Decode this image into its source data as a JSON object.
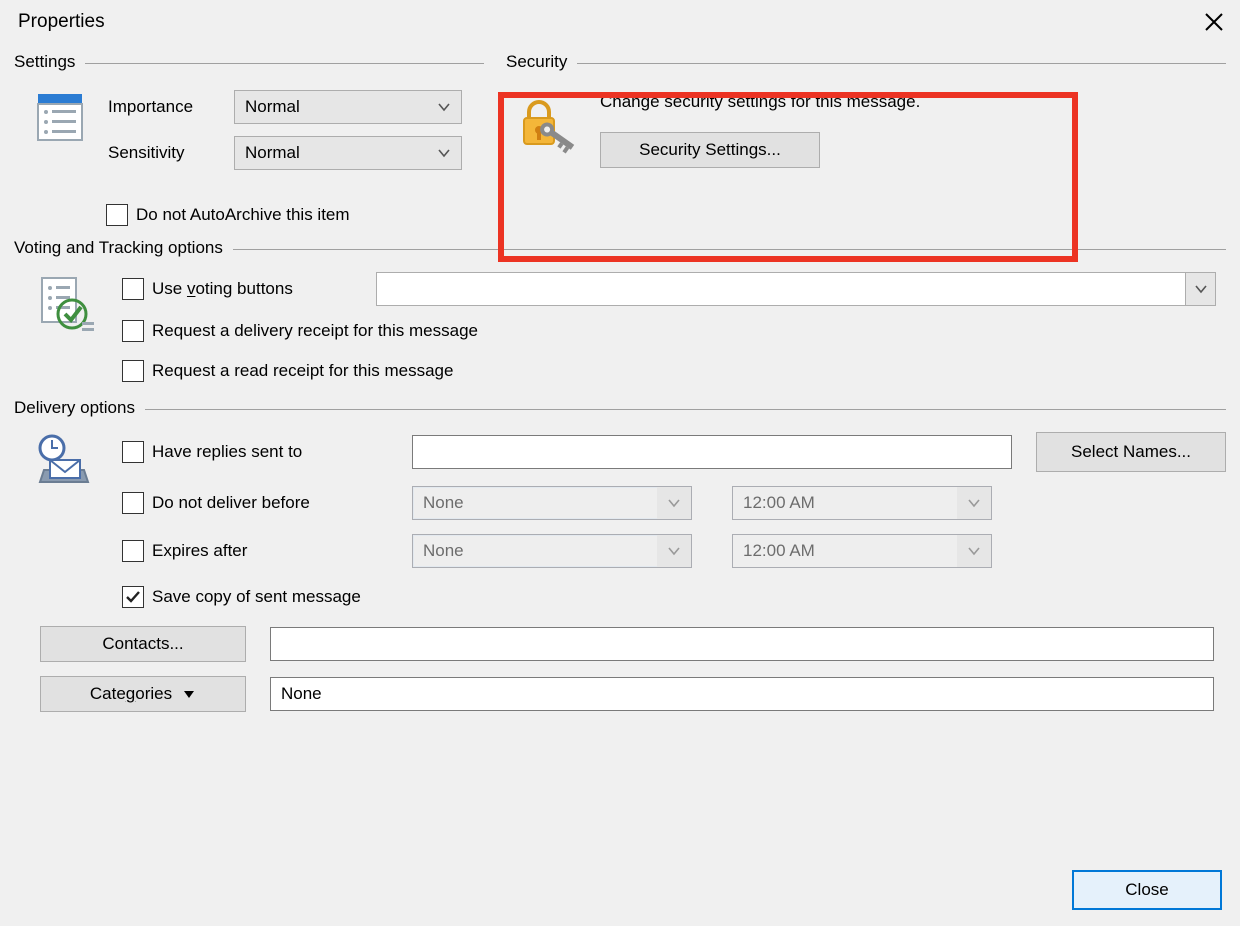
{
  "title": "Properties",
  "groups": {
    "settings": {
      "label": "Settings",
      "importance_label": "Importance",
      "importance_value": "Normal",
      "sensitivity_label": "Sensitivity",
      "sensitivity_value": "Normal",
      "autoarchive_label": "Do not AutoArchive this item",
      "autoarchive_checked": false
    },
    "security": {
      "label": "Security",
      "description": "Change security settings for this message.",
      "button_label": "Security Settings..."
    },
    "voting_tracking": {
      "label": "Voting and Tracking options",
      "use_voting_label": "Use voting buttons",
      "use_voting_checked": false,
      "voting_value": "",
      "delivery_receipt_label": "Request a delivery receipt for this message",
      "delivery_receipt_checked": false,
      "read_receipt_label": "Request a read receipt for this message",
      "read_receipt_checked": false
    },
    "delivery": {
      "label": "Delivery options",
      "have_replies_label": "Have replies sent to",
      "have_replies_checked": false,
      "have_replies_value": "",
      "select_names_label": "Select Names...",
      "not_before_label": "Do not deliver before",
      "not_before_checked": false,
      "not_before_date": "None",
      "not_before_time": "12:00 AM",
      "expires_label": "Expires after",
      "expires_checked": false,
      "expires_date": "None",
      "expires_time": "12:00 AM",
      "save_copy_label": "Save copy of sent message",
      "save_copy_checked": true
    }
  },
  "bottom": {
    "contacts_label": "Contacts...",
    "contacts_value": "",
    "categories_label": "Categories",
    "categories_value": "None"
  },
  "footer": {
    "close_label": "Close"
  }
}
